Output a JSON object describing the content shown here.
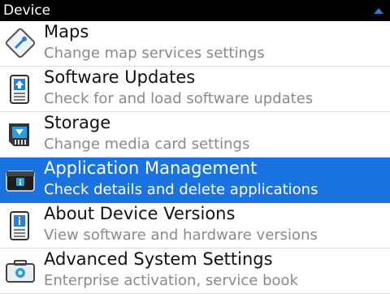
{
  "window": {
    "title": "Device"
  },
  "items": [
    {
      "label": "Maps",
      "description": "Change map services settings",
      "icon": "maps-icon",
      "selected": false
    },
    {
      "label": "Software Updates",
      "description": "Check for and load software updates",
      "icon": "software-update-icon",
      "selected": false
    },
    {
      "label": "Storage",
      "description": "Change media card settings",
      "icon": "storage-card-icon",
      "selected": false
    },
    {
      "label": "Application Management",
      "description": "Check details and delete applications",
      "icon": "application-management-icon",
      "selected": true
    },
    {
      "label": "About Device Versions",
      "description": "View software and hardware versions",
      "icon": "device-info-icon",
      "selected": false
    },
    {
      "label": "Advanced System Settings",
      "description": "Enterprise activation, service book",
      "icon": "advanced-settings-icon",
      "selected": false
    }
  ],
  "colors": {
    "selection": "#1a73e0",
    "scroll_indicator": "#2a7fd4"
  }
}
